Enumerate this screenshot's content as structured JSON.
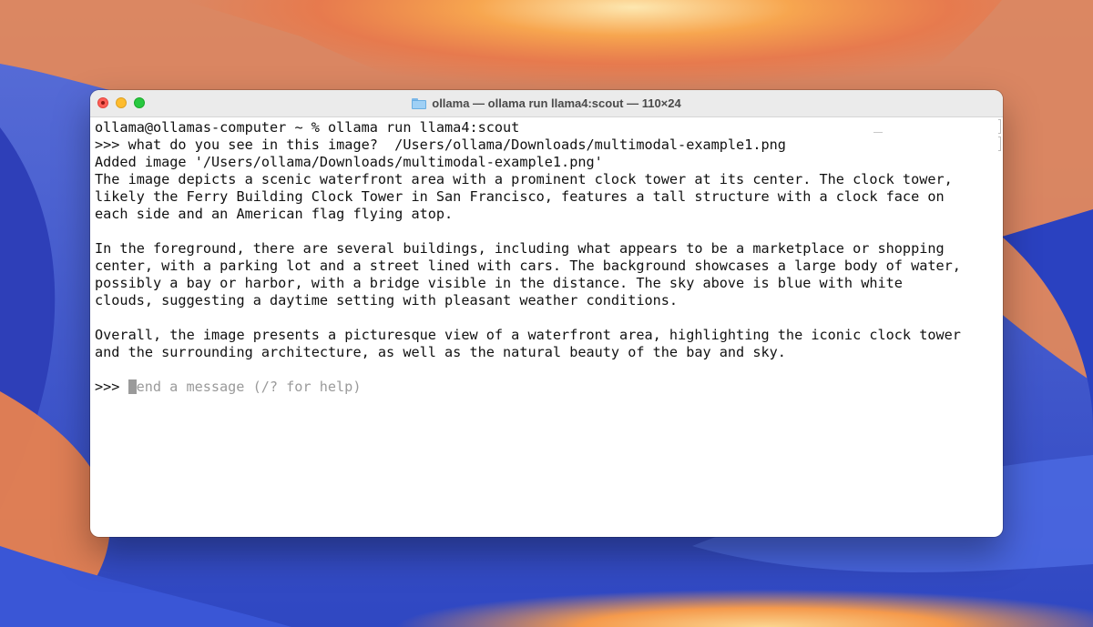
{
  "window": {
    "title": "ollama — ollama run llama4:scout — 110×24"
  },
  "terminal": {
    "lines": [
      "ollama@ollamas-computer ~ % ollama run llama4:scout",
      ">>> what do you see in this image?  /Users/ollama/Downloads/multimodal-example1.png",
      "Added image '/Users/ollama/Downloads/multimodal-example1.png'",
      "The image depicts a scenic waterfront area with a prominent clock tower at its center. The clock tower,",
      "likely the Ferry Building Clock Tower in San Francisco, features a tall structure with a clock face on",
      "each side and an American flag flying atop.",
      "",
      "In the foreground, there are several buildings, including what appears to be a marketplace or shopping",
      "center, with a parking lot and a street lined with cars. The background showcases a large body of water,",
      "possibly a bay or harbor, with a bridge visible in the distance. The sky above is blue with white",
      "clouds, suggesting a daytime setting with pleasant weather conditions.",
      "",
      "Overall, the image presents a picturesque view of a waterfront area, highlighting the iconic clock tower",
      "and the surrounding architecture, as well as the natural beauty of the bay and sky.",
      ""
    ],
    "prompt": ">>> ",
    "input_placeholder": "end a message (/? for help)"
  },
  "icons": {
    "title_icon": "folder-icon",
    "close": "close-icon",
    "minimize": "minimize-icon",
    "maximize": "maximize-icon"
  },
  "colors": {
    "close": "#ff5f57",
    "minimize": "#febc2e",
    "maximize": "#28c840",
    "titlebar": "#ebebeb",
    "terminal_bg": "#ffffff",
    "terminal_text": "#111111",
    "placeholder_text": "#9a9a9a"
  }
}
